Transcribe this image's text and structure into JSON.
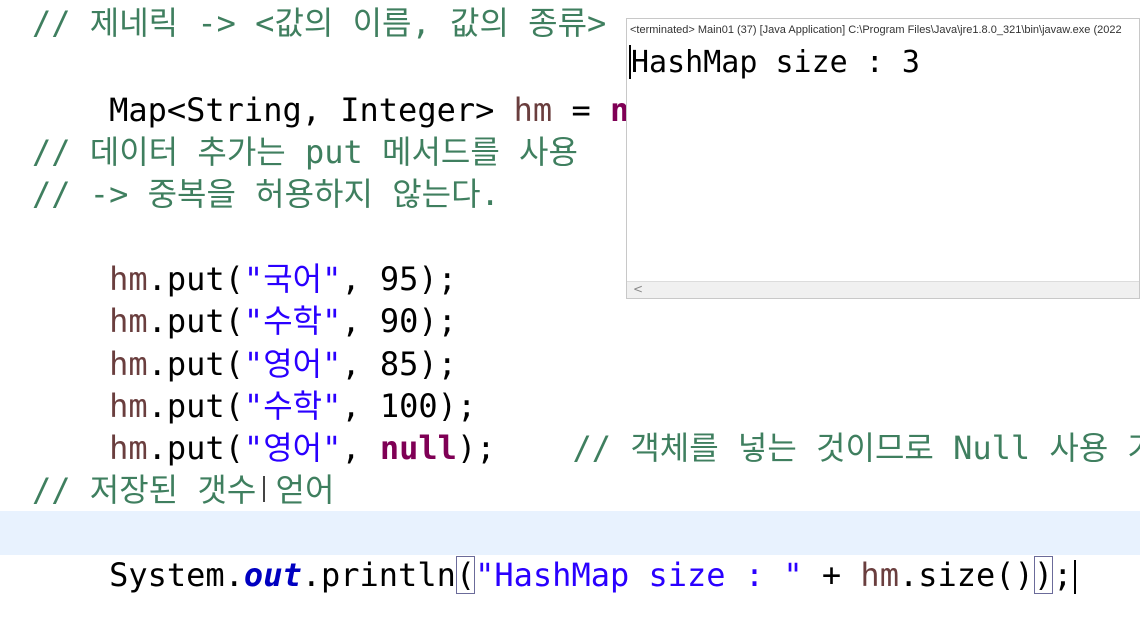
{
  "editor": {
    "lines": {
      "l1_comment": "// 제네릭 -> <값의 이름, 값의 종류>",
      "l2_type": "Map<String, Integer> ",
      "l2_var": "hm",
      "l2_eq": " = ",
      "l2_new": "new",
      "l4_comment": "// 데이터 추가는 put 메서드를 사용",
      "l5_comment": "// -> 중복을 허용하지 않는다.",
      "put1": {
        "obj": "hm",
        "method": ".put(",
        "key": "\"국어\"",
        "sep": ", ",
        "val": "95",
        "end": ");"
      },
      "put2": {
        "obj": "hm",
        "method": ".put(",
        "key": "\"수학\"",
        "sep": ", ",
        "val": "90",
        "end": ");"
      },
      "put3": {
        "obj": "hm",
        "method": ".put(",
        "key": "\"영어\"",
        "sep": ", ",
        "val": "85",
        "end": ");"
      },
      "put4": {
        "obj": "hm",
        "method": ".put(",
        "key": "\"수학\"",
        "sep": ", ",
        "val": "100",
        "end": ");"
      },
      "put5": {
        "obj": "hm",
        "method": ".put(",
        "key": "\"영어\"",
        "sep": ", ",
        "val": "null",
        "end": ");",
        "comment": "    // 객체를 넣는 것이므로 Null 사용 가능"
      },
      "l12_comment": "// 저장된 갯수 얻어",
      "l13": {
        "cls": "System.",
        "field": "out",
        "method": ".println",
        "open": "(",
        "str": "\"HashMap size : \"",
        "plus": " + ",
        "obj": "hm",
        "call": ".size()",
        "close": ")",
        "end": ";"
      }
    }
  },
  "console": {
    "header": "<terminated> Main01 (37) [Java Application] C:\\Program Files\\Java\\jre1.8.0_321\\bin\\javaw.exe (2022",
    "output": "HashMap size : 3",
    "scroll_icon": "<"
  },
  "colors": {
    "comment": "#3f7f5f",
    "keyword": "#7f0055",
    "string": "#2a00ff",
    "field": "#6a3e3e",
    "static_field": "#0000c0",
    "current_line": "#e8f2fe"
  }
}
